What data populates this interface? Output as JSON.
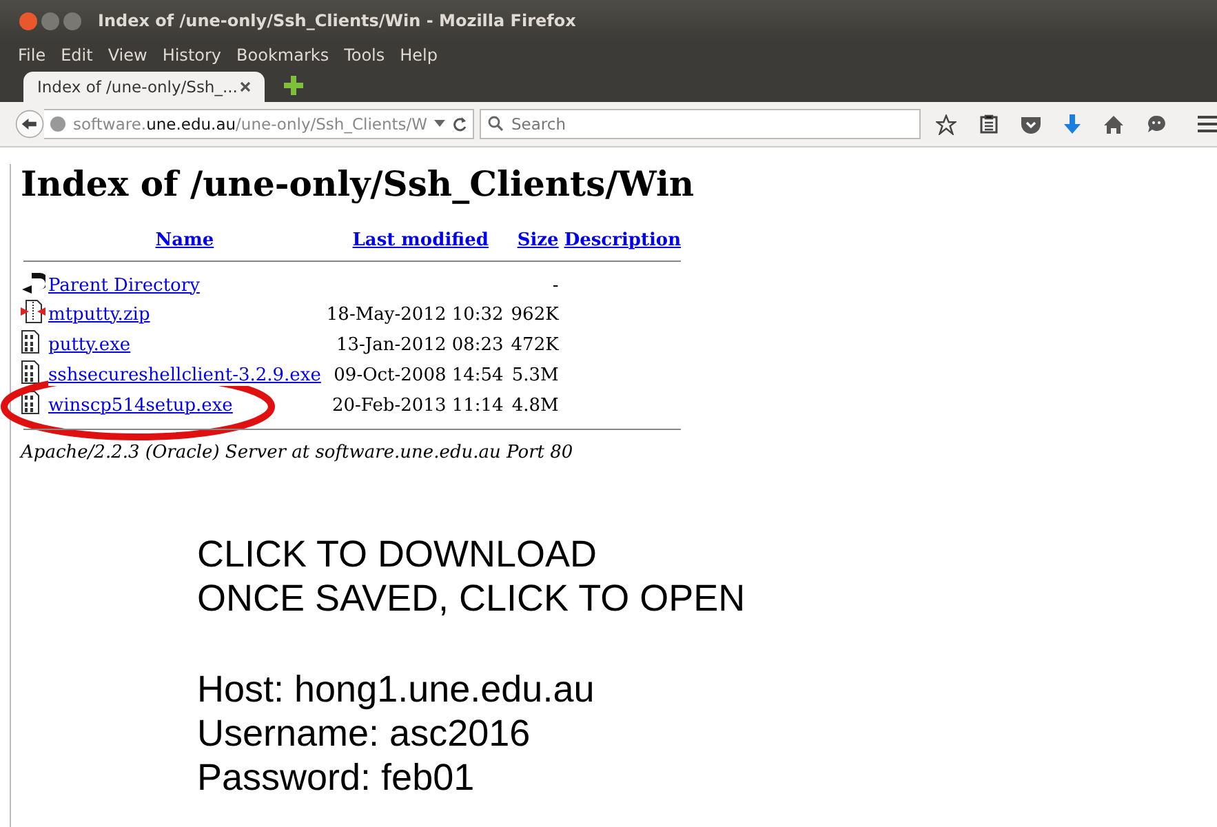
{
  "window": {
    "title": "Index of /une-only/Ssh_Clients/Win - Mozilla Firefox"
  },
  "menu": [
    "File",
    "Edit",
    "View",
    "History",
    "Bookmarks",
    "Tools",
    "Help"
  ],
  "tabs": [
    {
      "label": "Index of /une-only/Ssh_...",
      "selected": true
    }
  ],
  "address": {
    "host_prefix": "software.",
    "host_domain": "une.edu.au",
    "path": "/une-only/Ssh_Clients/W"
  },
  "search": {
    "placeholder": "Search"
  },
  "page": {
    "heading": "Index of /une-only/Ssh_Clients/Win",
    "columns": [
      "Name",
      "Last modified",
      "Size",
      "Description"
    ],
    "rows": [
      {
        "kind": "parent",
        "name": "Parent Directory",
        "modified": "",
        "size": "-"
      },
      {
        "kind": "archive",
        "name": "mtputty.zip",
        "modified": "18-May-2012 10:32",
        "size": "962K"
      },
      {
        "kind": "binary",
        "name": "putty.exe",
        "modified": "13-Jan-2012 08:23",
        "size": "472K"
      },
      {
        "kind": "binary",
        "name": "sshsecureshellclient-3.2.9.exe",
        "modified": "09-Oct-2008 14:54",
        "size": "5.3M"
      },
      {
        "kind": "binary",
        "name": "winscp514setup.exe",
        "modified": "20-Feb-2013 11:14",
        "size": "4.8M"
      }
    ],
    "footer": "Apache/2.2.3 (Oracle) Server at software.une.edu.au Port 80"
  },
  "instructions": [
    "CLICK TO DOWNLOAD",
    "ONCE SAVED, CLICK TO OPEN"
  ],
  "credentials": [
    "Host: hong1.une.edu.au",
    "Username: asc2016",
    "Password: feb01"
  ]
}
